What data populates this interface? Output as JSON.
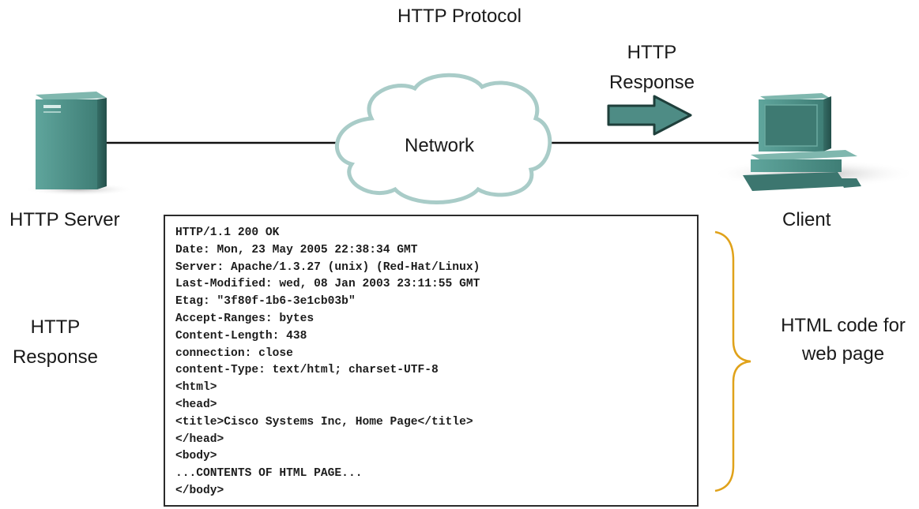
{
  "title": "HTTP Protocol",
  "server": {
    "label": "HTTP Server"
  },
  "network": {
    "label": "Network"
  },
  "client": {
    "label": "Client"
  },
  "response_arrow": {
    "line1": "HTTP",
    "line2": "Response"
  },
  "side_label": {
    "line1": "HTTP",
    "line2": "Response"
  },
  "brace_label": {
    "line1": "HTML code for",
    "line2": "web page"
  },
  "colors": {
    "device_teal": "#4f8f87",
    "device_dark": "#2f625c",
    "arrow_fill": "#4e8c85",
    "brace": "#e0a21a",
    "cloud_stroke": "#9fc4c0",
    "cable": "#111111"
  },
  "icons": [
    "server-icon",
    "cloud-icon",
    "client-computer-icon",
    "arrow-right-icon",
    "mouse-cursor-icon"
  ],
  "code_lines": [
    "HTTP/1.1 200 OK",
    "Date: Mon, 23 May 2005 22:38:34 GMT",
    "Server: Apache/1.3.27 (unix) (Red-Hat/Linux)",
    "Last-Modified: wed, 08 Jan 2003 23:11:55 GMT",
    "Etag: \"3f80f-1b6-3e1cb03b\"",
    "Accept-Ranges: bytes",
    "Content-Length: 438",
    "connection: close",
    "content-Type: text/html; charset-UTF-8",
    "<html>",
    "<head>",
    "<title>Cisco Systems Inc, Home Page</title>",
    "</head>",
    "<body>",
    "...CONTENTS OF HTML PAGE...",
    "</body>"
  ]
}
